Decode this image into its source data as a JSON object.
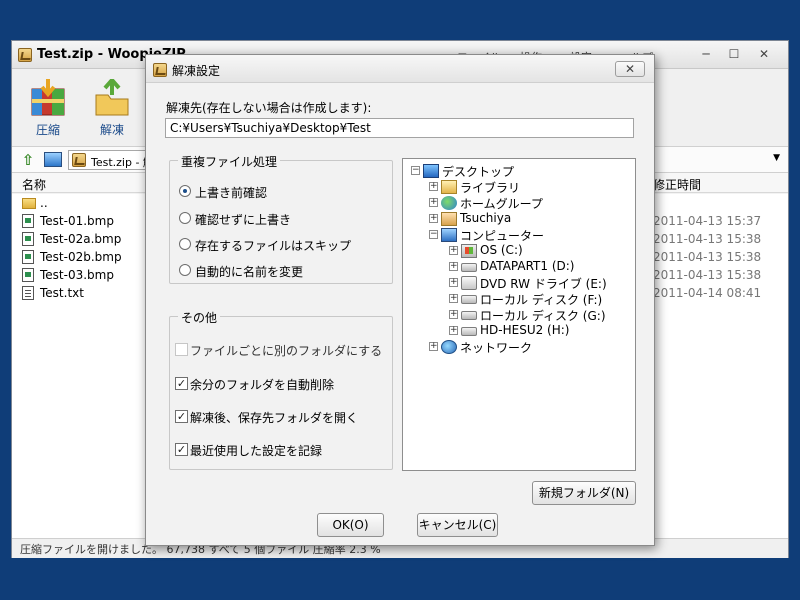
{
  "main_window": {
    "title": "Test.zip - WoopieZIP",
    "menu": [
      "ファイル",
      "操作",
      "設定",
      "ヘルプ"
    ],
    "window_buttons": [
      "─",
      "☐",
      "✕"
    ],
    "toolbar": [
      {
        "label": "圧縮",
        "icon": "compress-icon"
      },
      {
        "label": "解凍",
        "icon": "extract-icon"
      }
    ],
    "address_path": "Test.zip - 解",
    "columns": {
      "name": "名称",
      "modified": "修正時間"
    },
    "files": [
      {
        "name": "..",
        "date": "",
        "type": "folder"
      },
      {
        "name": "Test-01.bmp",
        "date": "2011-04-13 15:37",
        "type": "bmp"
      },
      {
        "name": "Test-02a.bmp",
        "date": "2011-04-13 15:38",
        "type": "bmp"
      },
      {
        "name": "Test-02b.bmp",
        "date": "2011-04-13 15:38",
        "type": "bmp"
      },
      {
        "name": "Test-03.bmp",
        "date": "2011-04-13 15:38",
        "type": "bmp"
      },
      {
        "name": "Test.txt",
        "date": "2011-04-14 08:41",
        "type": "txt"
      }
    ],
    "status": "圧縮ファイルを開けました。 67,738 すべて 5 個ファイル 圧縮率 2.3 %"
  },
  "dialog": {
    "title": "解凍設定",
    "close": "✕",
    "dest_label": "解凍先(存在しない場合は作成します):",
    "dest_value": "C:¥Users¥Tsuchiya¥Desktop¥Test",
    "dup_group": {
      "title": "重複ファイル処理",
      "options": [
        {
          "label": "上書き前確認",
          "selected": true
        },
        {
          "label": "確認せずに上書き",
          "selected": false
        },
        {
          "label": "存在するファイルはスキップ",
          "selected": false
        },
        {
          "label": "自動的に名前を変更",
          "selected": false
        }
      ]
    },
    "other_group": {
      "title": "その他",
      "options": [
        {
          "label": "ファイルごとに別のフォルダにする",
          "checked": false,
          "enabled": false
        },
        {
          "label": "余分のフォルダを自動削除",
          "checked": true,
          "enabled": true
        },
        {
          "label": "解凍後、保存先フォルダを開く",
          "checked": true,
          "enabled": true
        },
        {
          "label": "最近使用した設定を記録",
          "checked": true,
          "enabled": true
        }
      ]
    },
    "tree": [
      {
        "label": "デスクトップ",
        "exp": "−",
        "icon": "desktop-icon"
      },
      {
        "label": "ライブラリ",
        "exp": "+",
        "icon": "library-icon"
      },
      {
        "label": "ホームグループ",
        "exp": "+",
        "icon": "homegroup-icon"
      },
      {
        "label": "Tsuchiya",
        "exp": "+",
        "icon": "user-folder-icon"
      },
      {
        "label": "コンピューター",
        "exp": "−",
        "icon": "computer-icon"
      },
      {
        "label": "OS (C:)",
        "exp": "+",
        "icon": "os-drive-icon"
      },
      {
        "label": "DATAPART1 (D:)",
        "exp": "+",
        "icon": "drive-icon"
      },
      {
        "label": "DVD RW ドライブ (E:)",
        "exp": "+",
        "icon": "dvd-drive-icon"
      },
      {
        "label": "ローカル ディスク (F:)",
        "exp": "+",
        "icon": "drive-icon"
      },
      {
        "label": "ローカル ディスク (G:)",
        "exp": "+",
        "icon": "drive-icon"
      },
      {
        "label": "HD-HESU2 (H:)",
        "exp": "+",
        "icon": "drive-icon"
      },
      {
        "label": "ネットワーク",
        "exp": "+",
        "icon": "network-icon"
      }
    ],
    "buttons": {
      "new_folder": "新規フォルダ(N)",
      "ok": "OK(O)",
      "cancel": "キャンセル(C)"
    }
  }
}
